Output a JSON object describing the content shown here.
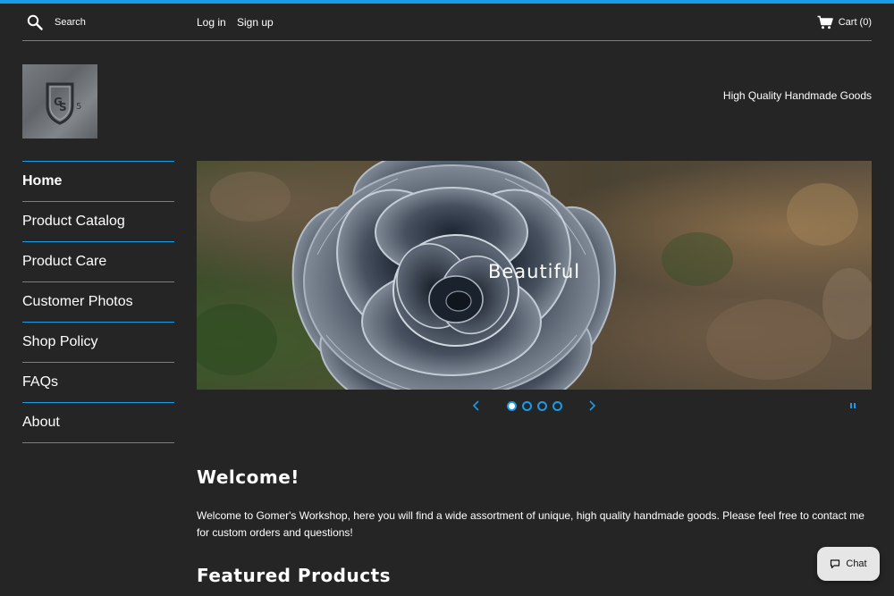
{
  "colors": {
    "background": "#252525",
    "accent": "#1a9be8",
    "text": "#ffffff",
    "chat_bg": "#e6e6e6"
  },
  "header": {
    "search_placeholder": "Search",
    "login_label": "Log in",
    "signup_label": "Sign up",
    "cart_label": "Cart (0)",
    "icons": {
      "search": "search-icon",
      "cart": "cart-icon"
    }
  },
  "brand": {
    "logo_icon": "shield-logo-icon",
    "tagline": "High Quality Handmade Goods"
  },
  "sidebar": {
    "items": [
      {
        "label": "Home",
        "active": true
      },
      {
        "label": "Product Catalog",
        "active": false
      },
      {
        "label": "Product Care",
        "active": false
      },
      {
        "label": "Customer Photos",
        "active": false
      },
      {
        "label": "Shop Policy",
        "active": false
      },
      {
        "label": "FAQs",
        "active": false
      },
      {
        "label": "About",
        "active": false
      }
    ]
  },
  "slideshow": {
    "caption": "Beautiful",
    "slide_count": 4,
    "current_slide": 1,
    "icons": {
      "prev": "chevron-left-icon",
      "next": "chevron-right-icon",
      "pause": "pause-icon"
    }
  },
  "main": {
    "welcome_title": "Welcome!",
    "welcome_text": "Welcome to Gomer's Workshop, here you will find a wide assortment of unique, high quality handmade goods. Please feel free to contact me for custom orders and questions!",
    "featured_title": "Featured Products"
  },
  "chat": {
    "label": "Chat",
    "icon": "chat-bubble-icon"
  }
}
